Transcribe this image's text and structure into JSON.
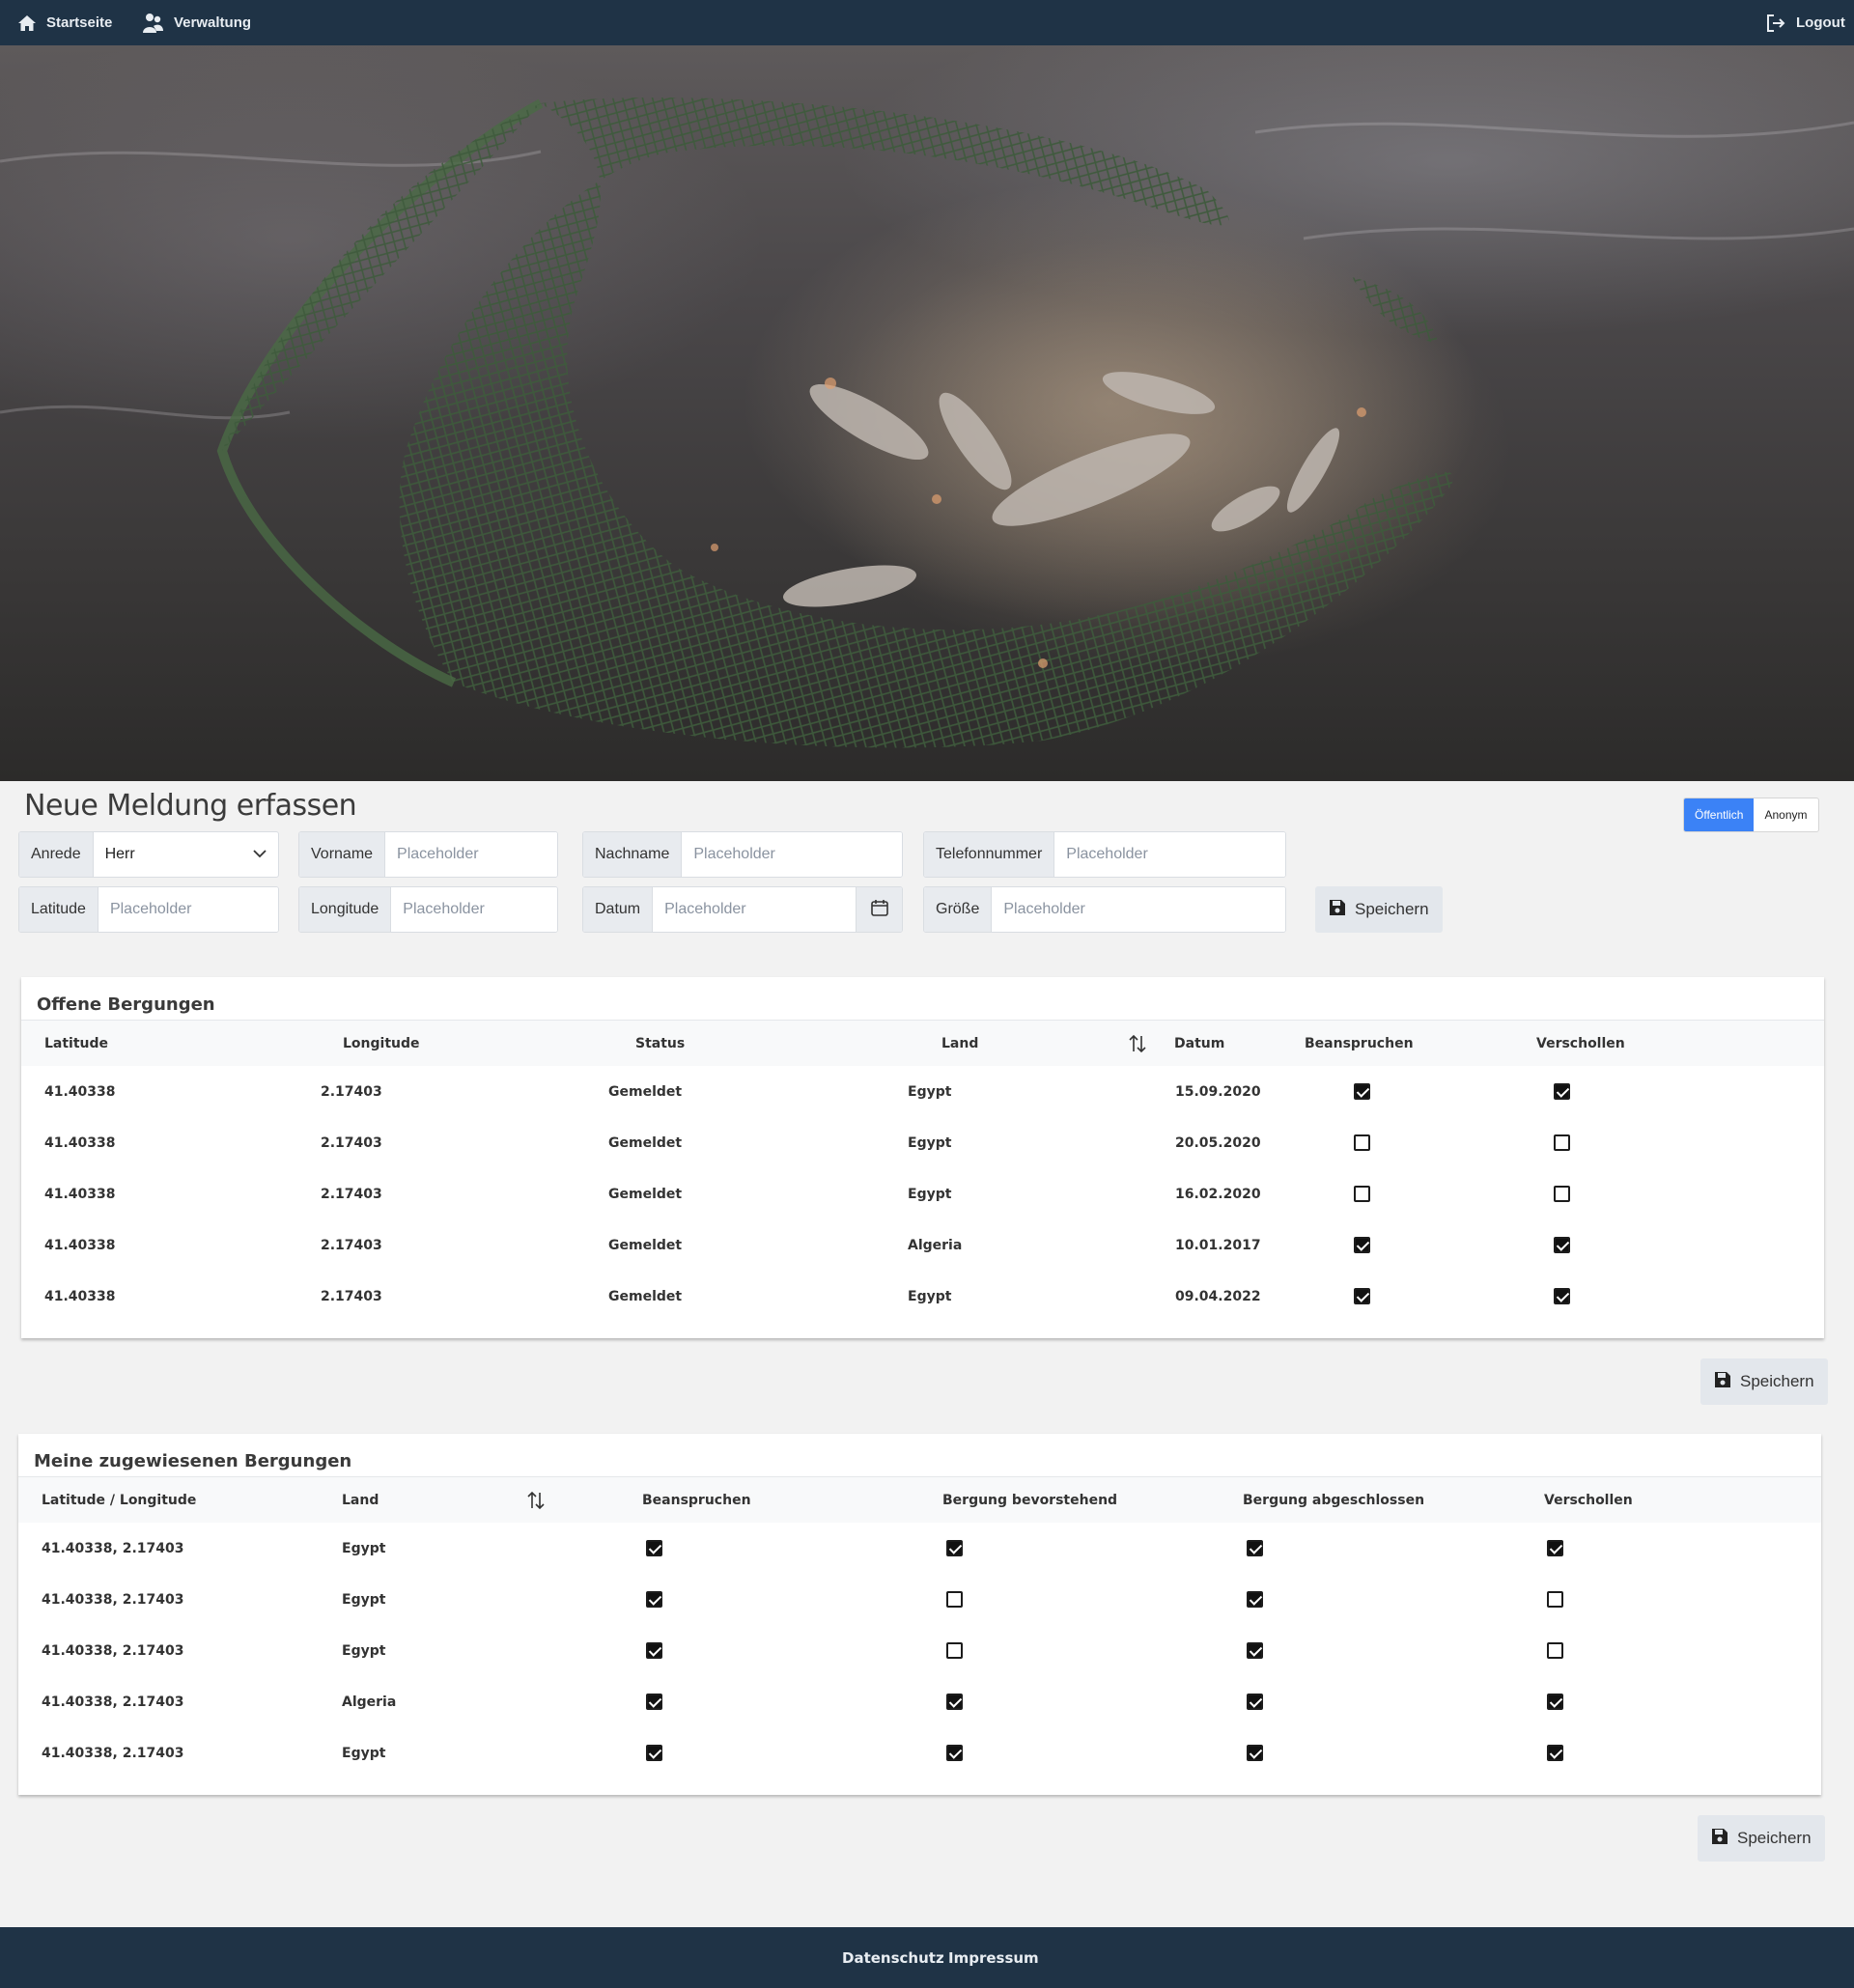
{
  "navbar": {
    "home": {
      "label": "Startseite",
      "icon": "home-icon"
    },
    "admin": {
      "label": "Verwaltung",
      "icon": "users-icon"
    },
    "logout": {
      "label": "Logout",
      "icon": "logout-icon"
    },
    "background": "#1f3346"
  },
  "hero": {
    "image": "fishing-net-with-fish-in-water-photo"
  },
  "form": {
    "title": "Neue Meldung erfassen",
    "visibility": {
      "options": [
        "Öffentlich",
        "Anonym"
      ],
      "selected": "Öffentlich"
    },
    "anrede": {
      "label": "Anrede",
      "value": "Herr"
    },
    "vorname": {
      "label": "Vorname",
      "placeholder": "Placeholder"
    },
    "nachname": {
      "label": "Nachname",
      "placeholder": "Placeholder"
    },
    "telefon": {
      "label": "Telefonnummer",
      "placeholder": "Placeholder"
    },
    "latitude": {
      "label": "Latitude",
      "placeholder": "Placeholder"
    },
    "longitude": {
      "label": "Longitude",
      "placeholder": "Placeholder"
    },
    "datum": {
      "label": "Datum",
      "placeholder": "Placeholder"
    },
    "groesse": {
      "label": "Größe",
      "placeholder": "Placeholder"
    },
    "save_label": "Speichern"
  },
  "open_table": {
    "title": "Offene Bergungen",
    "headers": {
      "lat": "Latitude",
      "lon": "Longitude",
      "status": "Status",
      "land": "Land",
      "datum": "Datum",
      "claim": "Beanspruchen",
      "lost": "Verschollen"
    },
    "rows": [
      {
        "lat": "41.40338",
        "lon": "2.17403",
        "status": "Gemeldet",
        "land": "Egypt",
        "datum": "15.09.2020",
        "claim": true,
        "lost": true
      },
      {
        "lat": "41.40338",
        "lon": "2.17403",
        "status": "Gemeldet",
        "land": "Egypt",
        "datum": "20.05.2020",
        "claim": false,
        "lost": false
      },
      {
        "lat": "41.40338",
        "lon": "2.17403",
        "status": "Gemeldet",
        "land": "Egypt",
        "datum": "16.02.2020",
        "claim": false,
        "lost": false
      },
      {
        "lat": "41.40338",
        "lon": "2.17403",
        "status": "Gemeldet",
        "land": "Algeria",
        "datum": "10.01.2017",
        "claim": true,
        "lost": true
      },
      {
        "lat": "41.40338",
        "lon": "2.17403",
        "status": "Gemeldet",
        "land": "Egypt",
        "datum": "09.04.2022",
        "claim": true,
        "lost": true
      }
    ],
    "save_label": "Speichern"
  },
  "my_table": {
    "title": "Meine zugewiesenen Bergungen",
    "headers": {
      "latlon": "Latitude / Longitude",
      "land": "Land",
      "claim": "Beanspruchen",
      "pending": "Bergung bevorstehend",
      "done": "Bergung abgeschlossen",
      "lost": "Verschollen"
    },
    "rows": [
      {
        "latlon": "41.40338, 2.17403",
        "land": "Egypt",
        "claim": true,
        "pending": true,
        "done": true,
        "lost": true
      },
      {
        "latlon": "41.40338, 2.17403",
        "land": "Egypt",
        "claim": true,
        "pending": false,
        "done": true,
        "lost": false
      },
      {
        "latlon": "41.40338, 2.17403",
        "land": "Egypt",
        "claim": true,
        "pending": false,
        "done": true,
        "lost": false
      },
      {
        "latlon": "41.40338, 2.17403",
        "land": "Algeria",
        "claim": true,
        "pending": true,
        "done": true,
        "lost": true
      },
      {
        "latlon": "41.40338, 2.17403",
        "land": "Egypt",
        "claim": true,
        "pending": true,
        "done": true,
        "lost": true
      }
    ],
    "save_label": "Speichern"
  },
  "footer": {
    "privacy": "Datenschutz",
    "imprint": "Impressum"
  },
  "colors": {
    "accent": "#3b82f6",
    "nav": "#1f3346",
    "page_bg": "#f2f2f2"
  }
}
